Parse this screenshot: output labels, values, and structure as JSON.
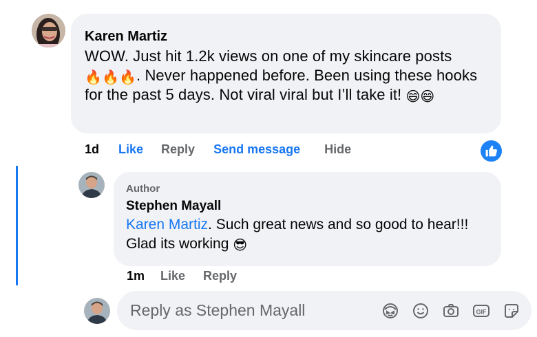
{
  "comment": {
    "author": "Karen Martiz",
    "text_part1": "WOW. Just hit 1.2k views on one of my skincare posts",
    "text_fire_emojis": "🔥🔥🔥",
    "text_part2": ". Never happened before. Been using these hooks for the past 5 days. Not viral viral but I’ll take it!",
    "text_end_emojis": "😄😄",
    "time": "1d",
    "like_label": "Like",
    "reply_label": "Reply",
    "send_message_label": "Send message",
    "hide_label": "Hide",
    "reaction_icon": "thumbs-up-icon"
  },
  "reply": {
    "author_tag": "Author",
    "author": "Stephen Mayall",
    "mention": "Karen Martiz",
    "text": ". Such great news and so good to hear!!! Glad its working",
    "emoji": "😎",
    "time": "1m",
    "like_label": "Like",
    "reply_label": "Reply"
  },
  "composer": {
    "placeholder": "Reply as Stephen Mayall",
    "icons": [
      "avatar-sticker-icon",
      "emoji-icon",
      "camera-icon",
      "gif-icon",
      "sticker-icon"
    ]
  },
  "colors": {
    "accent": "#1877f2",
    "bubble": "#f0f2f5",
    "muted": "#65676b"
  }
}
